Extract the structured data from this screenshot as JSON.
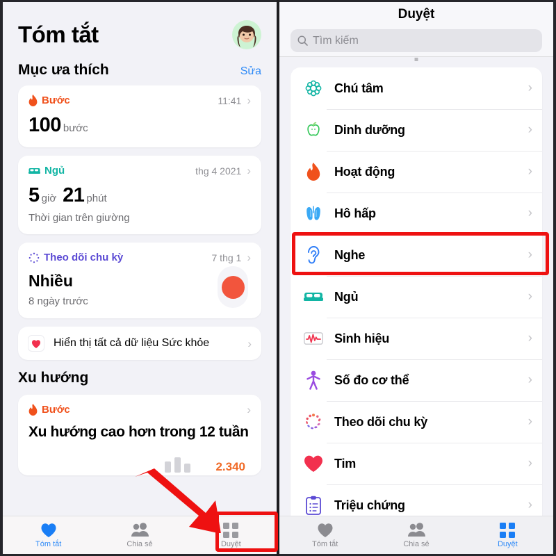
{
  "colors": {
    "accent_blue": "#2e8af7",
    "highlight_red": "#ee1111",
    "orange": "#f06a27",
    "teal": "#12b5a4",
    "page_bg": "#f2f2f7"
  },
  "left_panel": {
    "title": "Tóm tắt",
    "avatar_name": "memoji-avatar",
    "favorites": {
      "section_title": "Mục ưa thích",
      "edit_label": "Sửa",
      "cards": [
        {
          "category": "Bước",
          "category_color": "#f0511c",
          "icon": "flame-icon",
          "time": "11:41",
          "value": "100",
          "unit": "bước"
        },
        {
          "category": "Ngủ",
          "category_color": "#12b5a4",
          "icon": "bed-icon",
          "time": "thg 4 2021",
          "value_1": "5",
          "unit_1": "giờ",
          "value_2": "21",
          "unit_2": "phút",
          "subtitle": "Thời gian trên giường"
        },
        {
          "category": "Theo dõi chu kỳ",
          "category_color": "#5b4ad4",
          "icon": "cycle-icon",
          "time": "7 thg 1",
          "value": "Nhiều",
          "subtitle": "8 ngày trước",
          "dot_color": "#f2553d"
        }
      ],
      "show_all_row": {
        "label": "Hiển thị tất cả dữ liệu Sức khỏe",
        "icon": "heart-icon"
      }
    },
    "trends": {
      "section_title": "Xu hướng",
      "card": {
        "category": "Bước",
        "icon": "flame-icon",
        "message": "Xu hướng cao hơn trong 12 tuần",
        "value": "2.340"
      }
    },
    "tabs": [
      {
        "label": "Tóm tắt",
        "icon": "heart-icon",
        "active": true
      },
      {
        "label": "Chia sẻ",
        "icon": "people-icon",
        "active": false
      },
      {
        "label": "Duyệt",
        "icon": "grid-icon",
        "active": false
      }
    ]
  },
  "right_panel": {
    "title": "Duyệt",
    "search": {
      "placeholder": "Tìm kiếm",
      "icon": "search-icon"
    },
    "items": [
      {
        "label": "Chú tâm",
        "icon": "mindfulness-icon",
        "color": "#12b5a4"
      },
      {
        "label": "Dinh dưỡng",
        "icon": "apple-icon",
        "color": "#34c759"
      },
      {
        "label": "Hoạt động",
        "icon": "flame-icon",
        "color": "#f0511c"
      },
      {
        "label": "Hô hấp",
        "icon": "lungs-icon",
        "color": "#3aa9f5"
      },
      {
        "label": "Nghe",
        "icon": "ear-icon",
        "color": "#2e7df7",
        "highlighted": true
      },
      {
        "label": "Ngủ",
        "icon": "bed-icon",
        "color": "#12b5a4"
      },
      {
        "label": "Sinh hiệu",
        "icon": "vitals-icon",
        "color": "#f0344f"
      },
      {
        "label": "Số đo cơ thể",
        "icon": "body-icon",
        "color": "#9a4ce0"
      },
      {
        "label": "Theo dõi chu kỳ",
        "icon": "cycle-icon",
        "color": "#e8607a"
      },
      {
        "label": "Tim",
        "icon": "heart-icon",
        "color": "#f2304e"
      },
      {
        "label": "Triệu chứng",
        "icon": "clipboard-icon",
        "color": "#5b4ad4"
      }
    ],
    "tabs": [
      {
        "label": "Tóm tắt",
        "icon": "heart-icon",
        "active": false
      },
      {
        "label": "Chia sẻ",
        "icon": "people-icon",
        "active": false
      },
      {
        "label": "Duyệt",
        "icon": "grid-icon",
        "active": true
      }
    ]
  },
  "annotations": {
    "highlight_nghe": "red-box-around-nghe-row",
    "highlight_duyet": "red-box-around-duyet-tab",
    "arrow": "red-arrow-pointing-to-duyet-tab"
  }
}
